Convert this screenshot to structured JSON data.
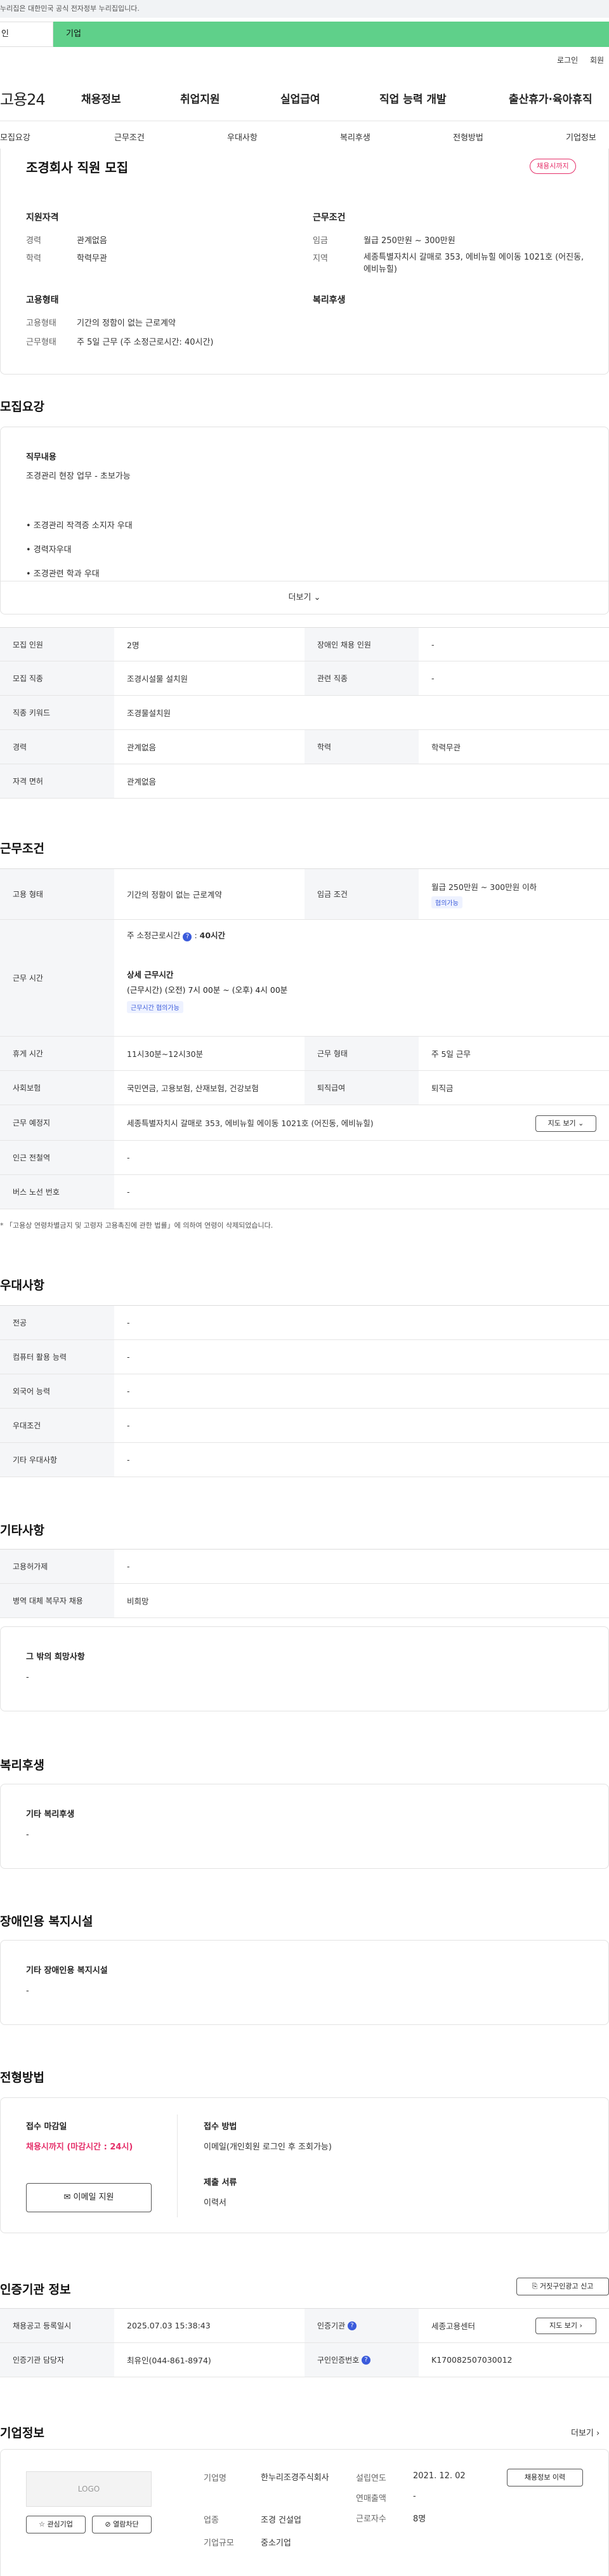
{
  "gov_notice": "누리집은 대한민국 공식 전자정부 누리집입니다.",
  "tabs": {
    "personal": "인",
    "company": "기업"
  },
  "util": {
    "login": "로그인",
    "join": "회원"
  },
  "logo": "고용24",
  "gnb": [
    "채용정보",
    "취업지원",
    "실업급여",
    "직업 능력 개발",
    "출산휴가·육아휴직"
  ],
  "snb": [
    "모집요강",
    "근무조건",
    "우대사항",
    "복리후생",
    "전형방법",
    "기업정보"
  ],
  "summary": {
    "title": "조경회사 직원 모집",
    "status_badge": "채용시까지",
    "qual_title": "지원자격",
    "cond_title": "근무조건",
    "emp_title": "고용형태",
    "welfare_title": "복리후생",
    "career_label": "경력",
    "career_value": "관계없음",
    "edu_label": "학력",
    "edu_value": "학력무관",
    "wage_label": "임금",
    "wage_value": "월급 250만원 ~ 300만원",
    "area_label": "지역",
    "area_value": "세종특별자치시 갈매로 353, 에비뉴힐 에이동 1021호 (어진동, 에비뉴힐)",
    "emptype_label": "고용형태",
    "emptype_value": "기간의 정함이 없는 근로계약",
    "worktype_label": "근무형태",
    "worktype_value": "주 5일 근무 (주 소정근로시간: 40시간)"
  },
  "recruit": {
    "section_title": "모집요강",
    "duty_title": "직무내용",
    "duty_lines": [
      "조경관리 현장 업무 - 초보가능",
      "",
      "• 조경관리 작격증 소지자 우대",
      "• 경력자우대",
      "• 조경관련 학과 우대"
    ],
    "more": "더보기",
    "rows": [
      {
        "k1": "모집 인원",
        "v1": "2명",
        "k2": "장애인 채용 인원",
        "v2": "-"
      },
      {
        "k1": "모집 직종",
        "v1": "조경시설물 설치원",
        "k2": "관련 직종",
        "v2": "-"
      },
      {
        "k1": "직종 키워드",
        "v1": "조경물설치원",
        "k2": "",
        "v2": ""
      },
      {
        "k1": "경력",
        "v1": "관계없음",
        "k2": "학력",
        "v2": "학력무관"
      },
      {
        "k1": "자격 면허",
        "v1": "관계없음",
        "k2": "",
        "v2": ""
      }
    ]
  },
  "work": {
    "section_title": "근무조건",
    "emptype_label": "고용 형태",
    "emptype_value": "기간의 정함이 없는 근로계약",
    "wage_label": "임금 조건",
    "wage_value": "월급 250만원 ~ 300만원 이하",
    "wage_chip": "협의가능",
    "hours_label": "근무 시간",
    "hours_weekly": "주 소정근로시간",
    "hours_weekly_value": "40시간",
    "hours_detail_title": "상세 근무시간",
    "hours_detail": "(근무시간) (오전) 7시 00분 ~ (오후) 4시 00분",
    "hours_chip": "근무시간 협의가능",
    "break_label": "휴게 시간",
    "break_value": "11시30분~12시30분",
    "form_label": "근무 형태",
    "form_value": "주 5일 근무",
    "ins_label": "사회보험",
    "ins_value": "국민연금, 고용보험, 산재보험, 건강보험",
    "sev_label": "퇴직급여",
    "sev_value": "퇴직금",
    "place_label": "근무 예정지",
    "place_value": "세종특별자치시 갈매로 353, 에비뉴힐 에이동 1021호 (어진동, 에비뉴힐)",
    "map_btn": "지도 보기",
    "station_label": "인근 전철역",
    "station_value": "-",
    "bus_label": "버스 노선 번호",
    "bus_value": "-",
    "note": "* 「고용상 연령차별금지 및 고령자 고용촉진에 관한 법률」에 의하여 연령이 삭제되었습니다."
  },
  "pref": {
    "section_title": "우대사항",
    "rows": [
      {
        "k": "전공",
        "v": "-"
      },
      {
        "k": "컴퓨터 활용 능력",
        "v": "-"
      },
      {
        "k": "외국어 능력",
        "v": "-"
      },
      {
        "k": "우대조건",
        "v": "-"
      },
      {
        "k": "기타 우대사항",
        "v": "-"
      }
    ]
  },
  "etc": {
    "section_title": "기타사항",
    "rows": [
      {
        "k": "고용허가제",
        "v": "-"
      },
      {
        "k": "병역 대체 복무자 채용",
        "v": "비희망"
      }
    ],
    "other_title": "그 밖의 희망사항",
    "other_value": "-"
  },
  "welfare": {
    "section_title": "복리후생",
    "box_title": "기타 복리후생",
    "box_value": "-"
  },
  "disabled": {
    "section_title": "장애인용 복지시설",
    "box_title": "기타 장애인용 복지시설",
    "box_value": "-"
  },
  "selection": {
    "section_title": "전형방법",
    "deadline_title": "접수 마감일",
    "deadline_value": "채용시까지 (마감시간 : 24시)",
    "email_btn": "이메일 지원",
    "method_title": "접수 방법",
    "method_value": "이메일(개인회원 로그인 후 조회가능)",
    "docs_title": "제출 서류",
    "docs_value": "이력서"
  },
  "agency": {
    "section_title": "인증기관 정보",
    "report_btn": "거짓구인광고 신고",
    "rows": [
      {
        "k1": "채용공고 등록일시",
        "v1": "2025.07.03 15:38:43",
        "k2": "인증기관",
        "v2": "세종고용센터",
        "btn": "지도 보기"
      },
      {
        "k1": "인증기관 담당자",
        "v1": "최유인(044-861-8974)",
        "k2": "구인인증번호",
        "v2": "K170082507030012",
        "btn": ""
      }
    ]
  },
  "company": {
    "section_title": "기업정보",
    "more": "더보기",
    "logo_text": "LOGO",
    "fav_btn": "관심기업",
    "block_btn": "열람차단",
    "name_label": "기업명",
    "name_value": "한누리조경주식회사",
    "industry_label": "업종",
    "industry_value": "조경 건설업",
    "size_label": "기업규모",
    "size_value": "중소기업",
    "founded_label": "설립연도",
    "founded_value": "2021. 12. 02",
    "sales_label": "연매출액",
    "sales_value": "-",
    "staff_label": "근로자수",
    "staff_value": "8명",
    "jobs_btn": "채용정보 이력"
  }
}
